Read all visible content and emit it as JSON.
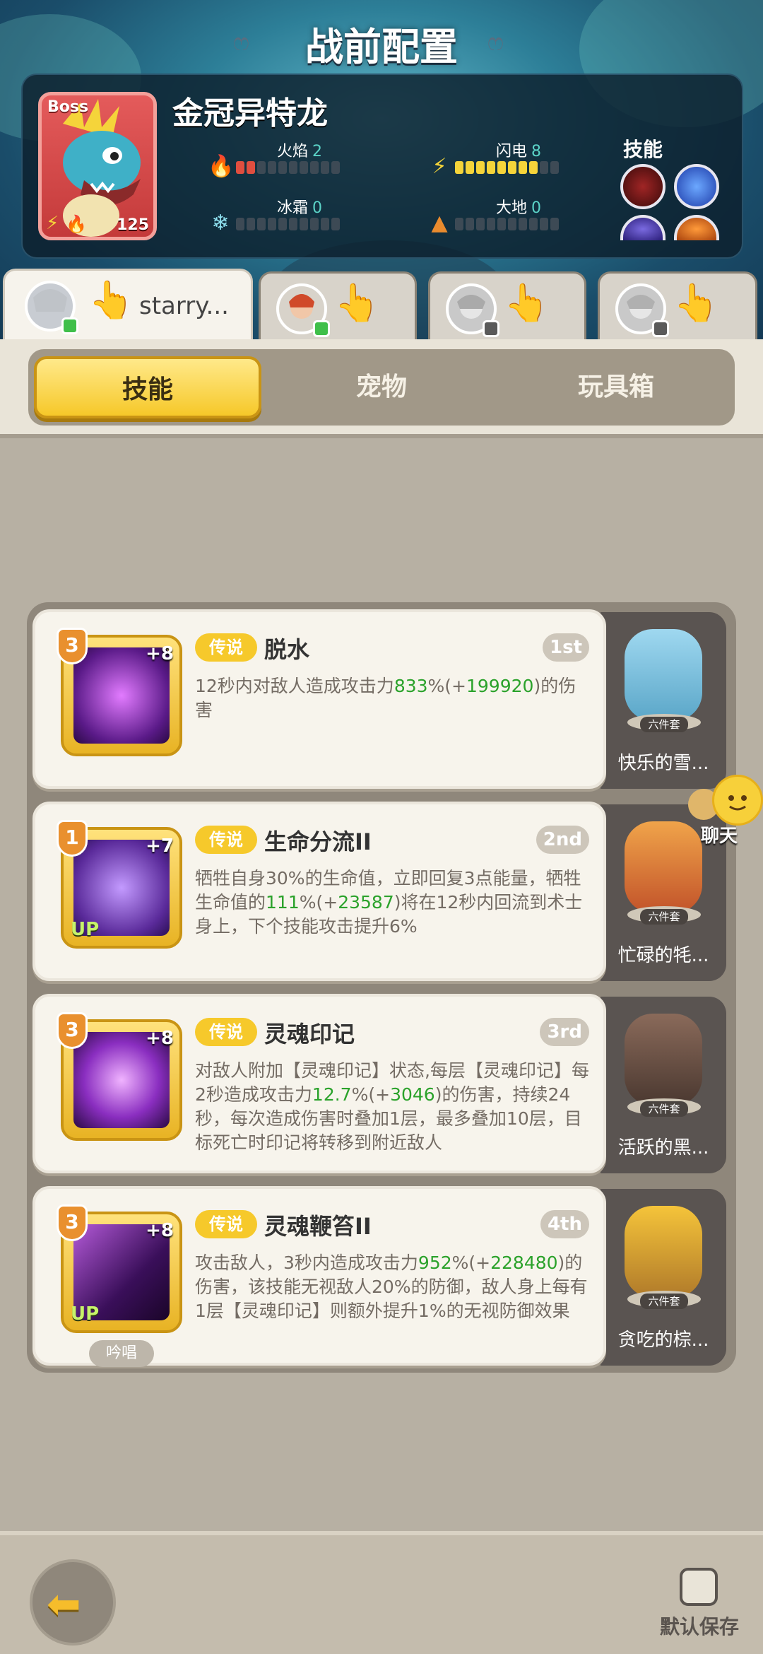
{
  "header": {
    "title": "战前配置"
  },
  "boss": {
    "tag": "Boss",
    "name": "金冠异特龙",
    "level": "125",
    "elements": [
      {
        "label": "火焰",
        "value": "2",
        "filled": 2,
        "color": "#e04e3f"
      },
      {
        "label": "闪电",
        "value": "8",
        "filled": 8,
        "color": "#f5d43a"
      },
      {
        "label": "冰霜",
        "value": "0",
        "filled": 0,
        "color": "#5bd3c7"
      },
      {
        "label": "大地",
        "value": "0",
        "filled": 0,
        "color": "#e98b2e"
      }
    ],
    "skills_label": "技能"
  },
  "players": [
    {
      "name": "starry...",
      "online": true,
      "active": true
    },
    {
      "name": "",
      "online": true,
      "active": false
    },
    {
      "name": "",
      "online": false,
      "active": false
    },
    {
      "name": "",
      "online": false,
      "active": false
    }
  ],
  "categories": [
    "技能",
    "宠物",
    "玩具箱"
  ],
  "skills": [
    {
      "level": "3",
      "plus": "+8",
      "up": false,
      "rarity": "传说",
      "name": "脱水",
      "rank": "1st",
      "desc_parts": [
        [
          "12秒内对敌人造成攻击力",
          ""
        ],
        [
          "833",
          "g"
        ],
        [
          "%(+",
          ""
        ],
        [
          "199920",
          "g"
        ],
        [
          ")的伤害",
          ""
        ]
      ],
      "pet": "快乐的雪..."
    },
    {
      "level": "1",
      "plus": "+7",
      "up": true,
      "rarity": "传说",
      "name": "生命分流II",
      "rank": "2nd",
      "desc_parts": [
        [
          "牺牲自身30%的生命值，立即回复3点能量，牺牲生命值的",
          ""
        ],
        [
          "111",
          "g"
        ],
        [
          "%(+",
          ""
        ],
        [
          "23587",
          "g"
        ],
        [
          ")将在12秒内回流到术士身上，下个技能攻击提升6%",
          ""
        ]
      ],
      "pet": "忙碌的牦..."
    },
    {
      "level": "3",
      "plus": "+8",
      "up": false,
      "rarity": "传说",
      "name": "灵魂印记",
      "rank": "3rd",
      "desc_parts": [
        [
          "对敌人附加【灵魂印记】状态,每层【灵魂印记】每2秒造成攻击力",
          ""
        ],
        [
          "12.7",
          "g"
        ],
        [
          "%(+",
          ""
        ],
        [
          "3046",
          "g"
        ],
        [
          ")的伤害，持续24秒，每次造成伤害时叠加1层，最多叠加10层，目标死亡时印记将转移到附近敌人",
          ""
        ]
      ],
      "pet": "活跃的黑..."
    },
    {
      "level": "3",
      "plus": "+8",
      "up": true,
      "rarity": "传说",
      "name": "灵魂鞭笞II",
      "rank": "4th",
      "desc_parts": [
        [
          "攻击敌人，3秒内造成攻击力",
          ""
        ],
        [
          "952",
          "g"
        ],
        [
          "%(+",
          ""
        ],
        [
          "228480",
          "g"
        ],
        [
          ")的伤害，该技能无视敌人20%的防御，敌人身上每有1层【灵魂印记】则额外提升1%的无视防御效果",
          ""
        ]
      ],
      "pet": "贪吃的棕...",
      "chant": "吟唱"
    }
  ],
  "pet_set_label": "六件套",
  "chat": {
    "label": "聊天"
  },
  "footer": {
    "save_label": "默认保存"
  }
}
